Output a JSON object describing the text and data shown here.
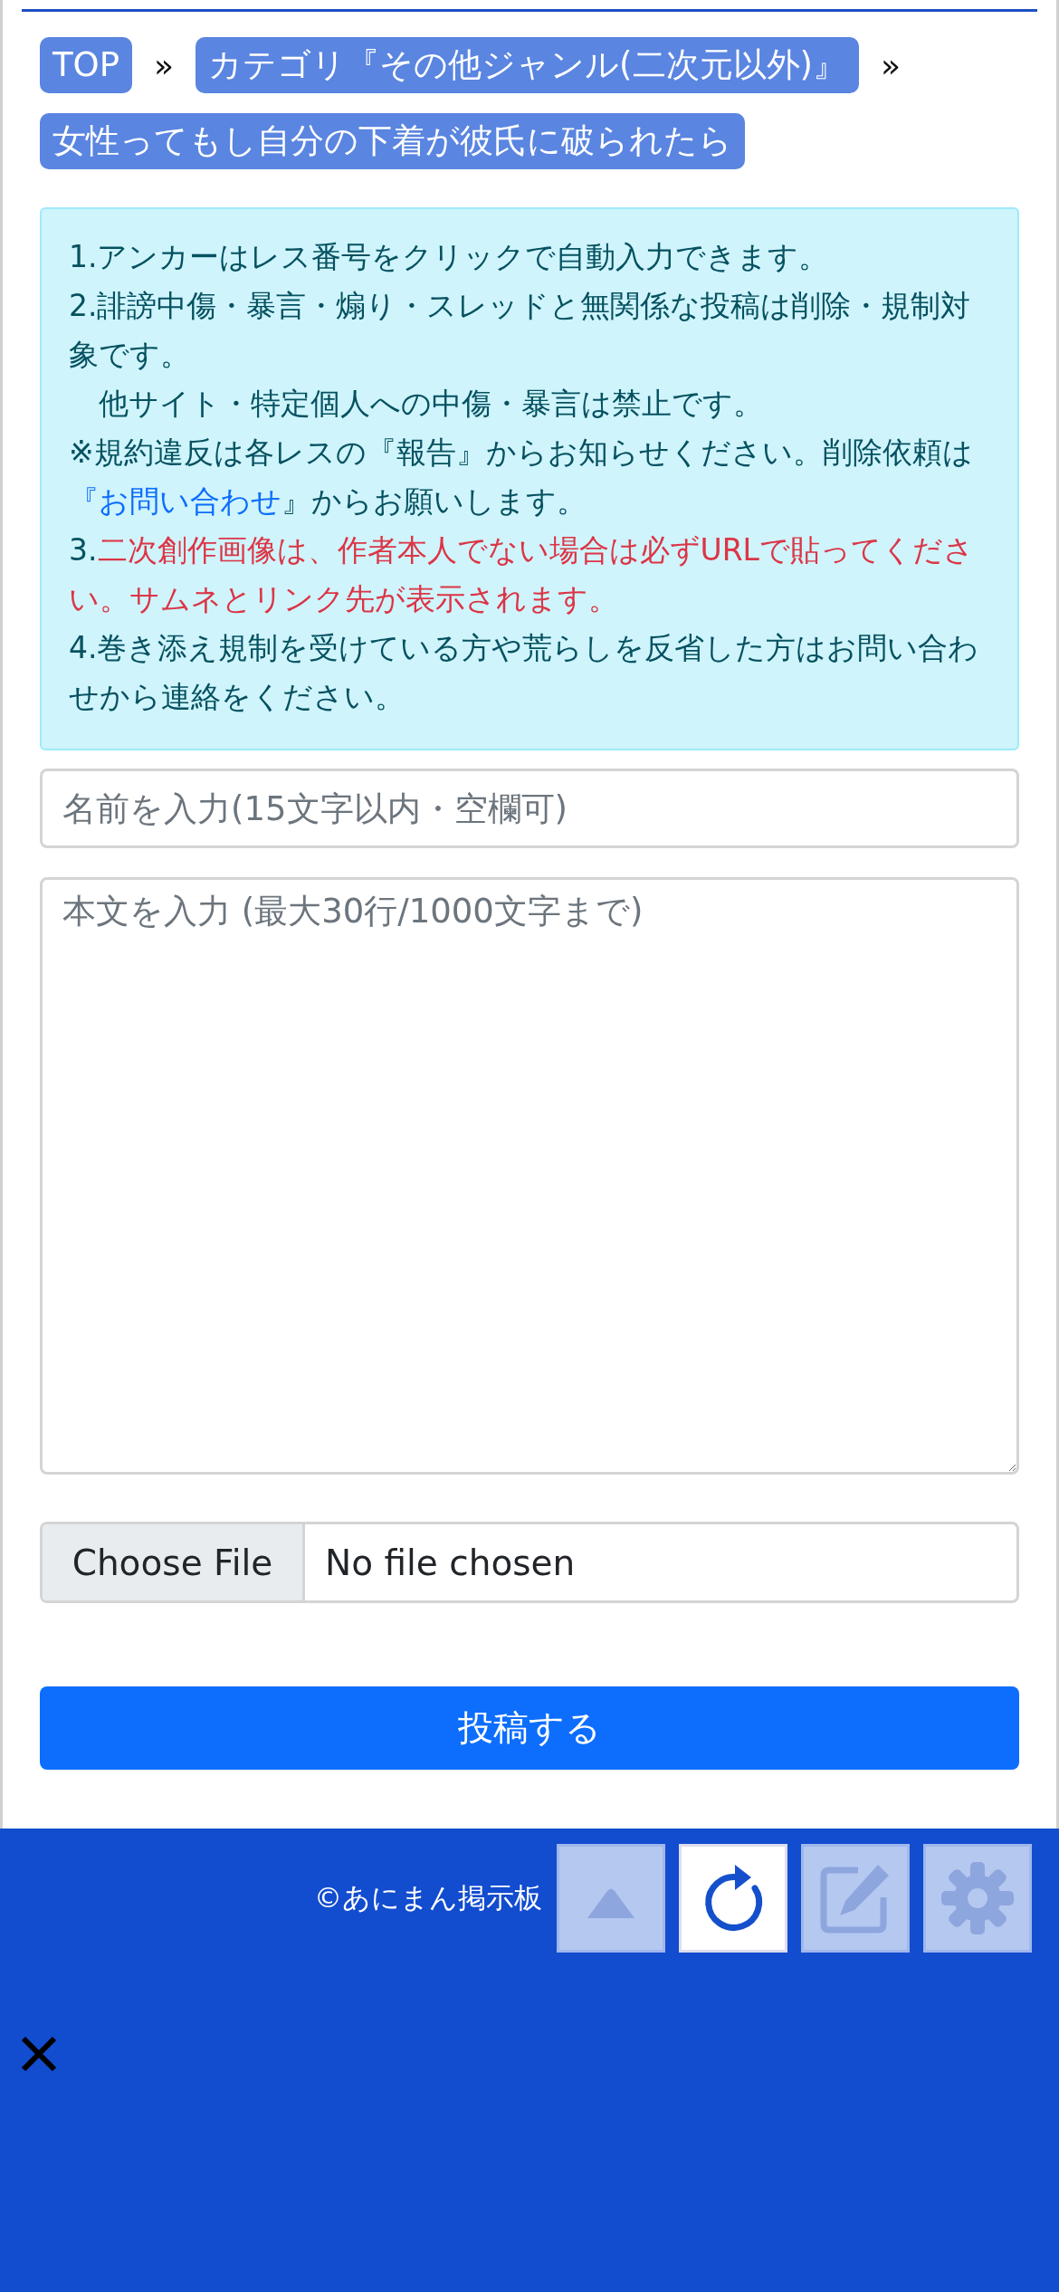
{
  "breadcrumbs": [
    {
      "label": "TOP"
    },
    {
      "label": "カテゴリ『その他ジャンル(二次元以外)』"
    },
    {
      "label": "女性ってもし自分の下着が彼氏に破られたら"
    }
  ],
  "breadcrumb_separator": "»",
  "notice": [
    [
      {
        "kind": "plain",
        "text": "1.アンカーはレス番号をクリックで自動入力できます。"
      }
    ],
    [
      {
        "kind": "plain",
        "text": "2.誹謗中傷・暴言・煽り・スレッドと無関係な投稿は削除・規制対象です。"
      }
    ],
    [
      {
        "kind": "plain",
        "text": "　他サイト・特定個人への中傷・暴言は禁止です。"
      }
    ],
    [
      {
        "kind": "plain",
        "text": "※規約違反は各レスの『報告』からお知らせください。削除依頼は"
      },
      {
        "kind": "link",
        "text": "『お問い合わせ"
      },
      {
        "kind": "plain",
        "text": "』からお願いします。"
      }
    ],
    [
      {
        "kind": "plain",
        "text": "3."
      },
      {
        "kind": "alert",
        "text": "二次創作画像は、作者本人でない場合は必ずURLで貼ってください。サムネとリンク先が表示されます。"
      }
    ],
    [
      {
        "kind": "plain",
        "text": "4.巻き添え規制を受けている方や荒らしを反省した方はお問い合わせから連絡をください。"
      }
    ]
  ],
  "name_field": {
    "placeholder": "名前を入力(15文字以内・空欄可)"
  },
  "body_field": {
    "placeholder": "本文を入力 (最大30行/1000文字まで)"
  },
  "file_input": {
    "button": "Choose File",
    "status": "No file chosen"
  },
  "submit_button": "投稿する",
  "footer": {
    "copyright": "©あにまん掲示板"
  },
  "floating_buttons": [
    {
      "kind": "top",
      "selected": false
    },
    {
      "kind": "reload",
      "selected": true
    },
    {
      "kind": "edit",
      "selected": false
    },
    {
      "kind": "settings",
      "selected": false
    }
  ]
}
